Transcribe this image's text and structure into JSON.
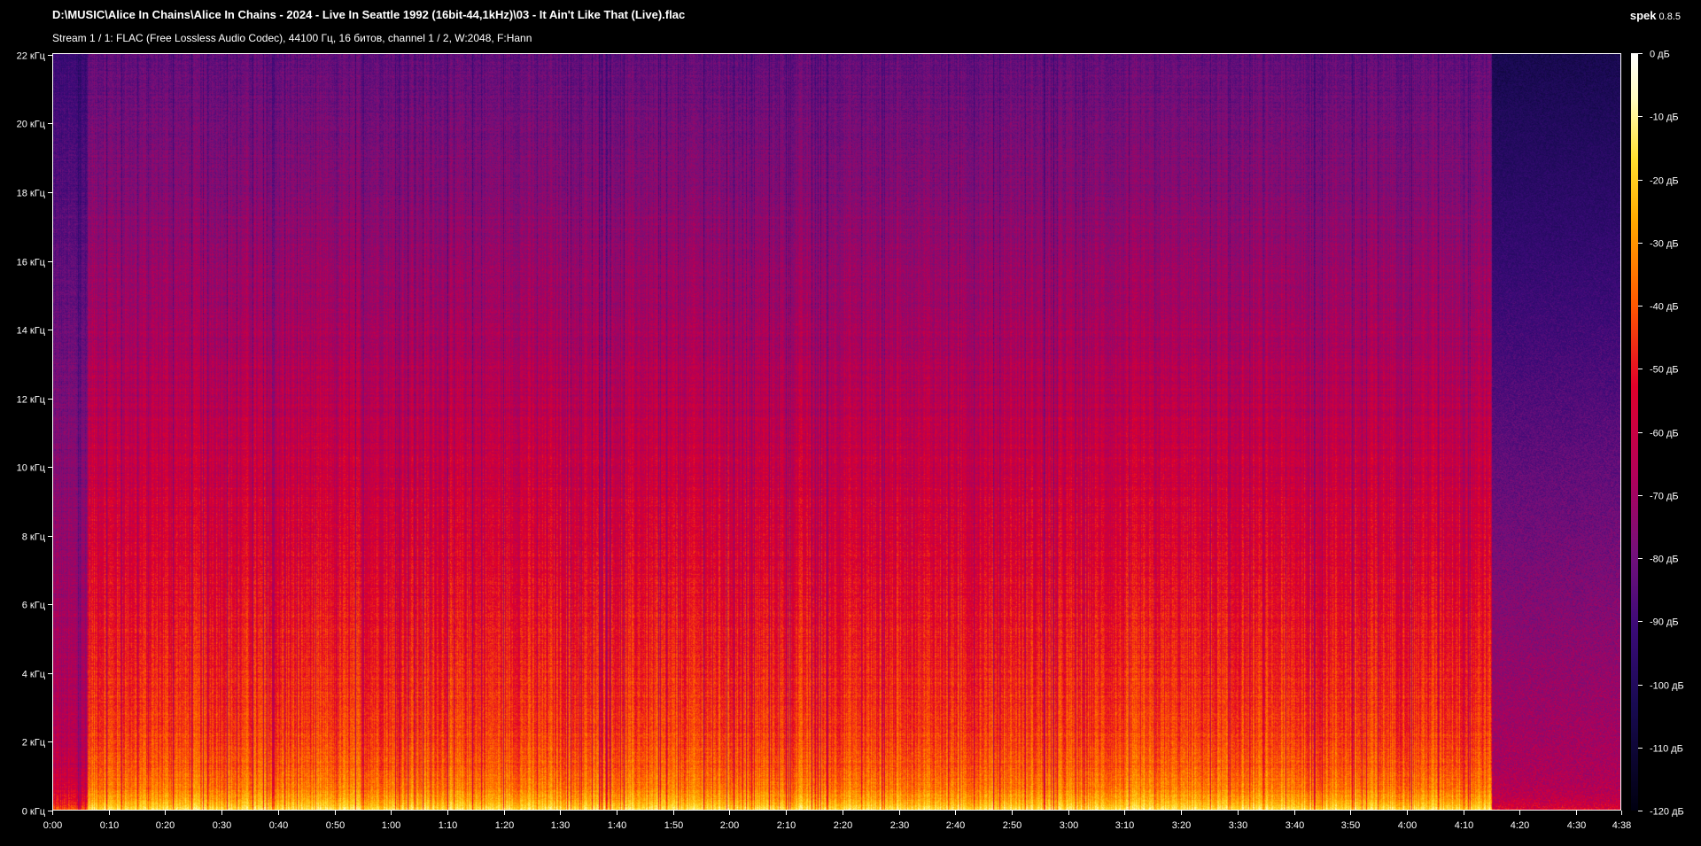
{
  "window": {
    "file_path": "D:\\MUSIC\\Alice In Chains\\Alice In Chains - 2024 - Live In Seattle 1992 (16bit-44,1kHz)\\03 - It Ain't Like That (Live).flac",
    "stream_info": "Stream 1 / 1: FLAC (Free Lossless Audio Codec), 44100 Гц, 16 битов, channel 1 / 2, W:2048, F:Hann",
    "app_name": "spek",
    "app_version": "0.8.5"
  },
  "frequency_axis": {
    "labels": [
      "0 кГц",
      "2 кГц",
      "4 кГц",
      "6 кГц",
      "8 кГц",
      "10 кГц",
      "12 кГц",
      "14 кГц",
      "16 кГц",
      "18 кГц",
      "20 кГц",
      "22 кГц"
    ],
    "max_khz": 22.05
  },
  "time_axis": {
    "labels": [
      "0:00",
      "0:10",
      "0:20",
      "0:30",
      "0:40",
      "0:50",
      "1:00",
      "1:10",
      "1:20",
      "1:30",
      "1:40",
      "1:50",
      "2:00",
      "2:10",
      "2:20",
      "2:30",
      "2:40",
      "2:50",
      "3:00",
      "3:10",
      "3:20",
      "3:30",
      "3:40",
      "3:50",
      "4:00",
      "4:10",
      "4:20",
      "4:30",
      "4:38"
    ],
    "tick_seconds": [
      0,
      10,
      20,
      30,
      40,
      50,
      60,
      70,
      80,
      90,
      100,
      110,
      120,
      130,
      140,
      150,
      160,
      170,
      180,
      190,
      200,
      210,
      220,
      230,
      240,
      250,
      260,
      270,
      278
    ],
    "duration_seconds": 278
  },
  "level_scale": {
    "labels": [
      "0 дБ",
      "-10 дБ",
      "-20 дБ",
      "-30 дБ",
      "-40 дБ",
      "-50 дБ",
      "-60 дБ",
      "-70 дБ",
      "-80 дБ",
      "-90 дБ",
      "-100 дБ",
      "-110 дБ",
      "-120 дБ"
    ],
    "min_db": -120,
    "max_db": 0
  },
  "colors": {
    "background": "#000000",
    "text": "#ffffff",
    "palette": [
      "#000010",
      "#180a52",
      "#3a0a78",
      "#74107a",
      "#b0005a",
      "#e0002a",
      "#ff5a00",
      "#ffaa00",
      "#ffe030",
      "#fffcc0",
      "#ffffff"
    ]
  }
}
